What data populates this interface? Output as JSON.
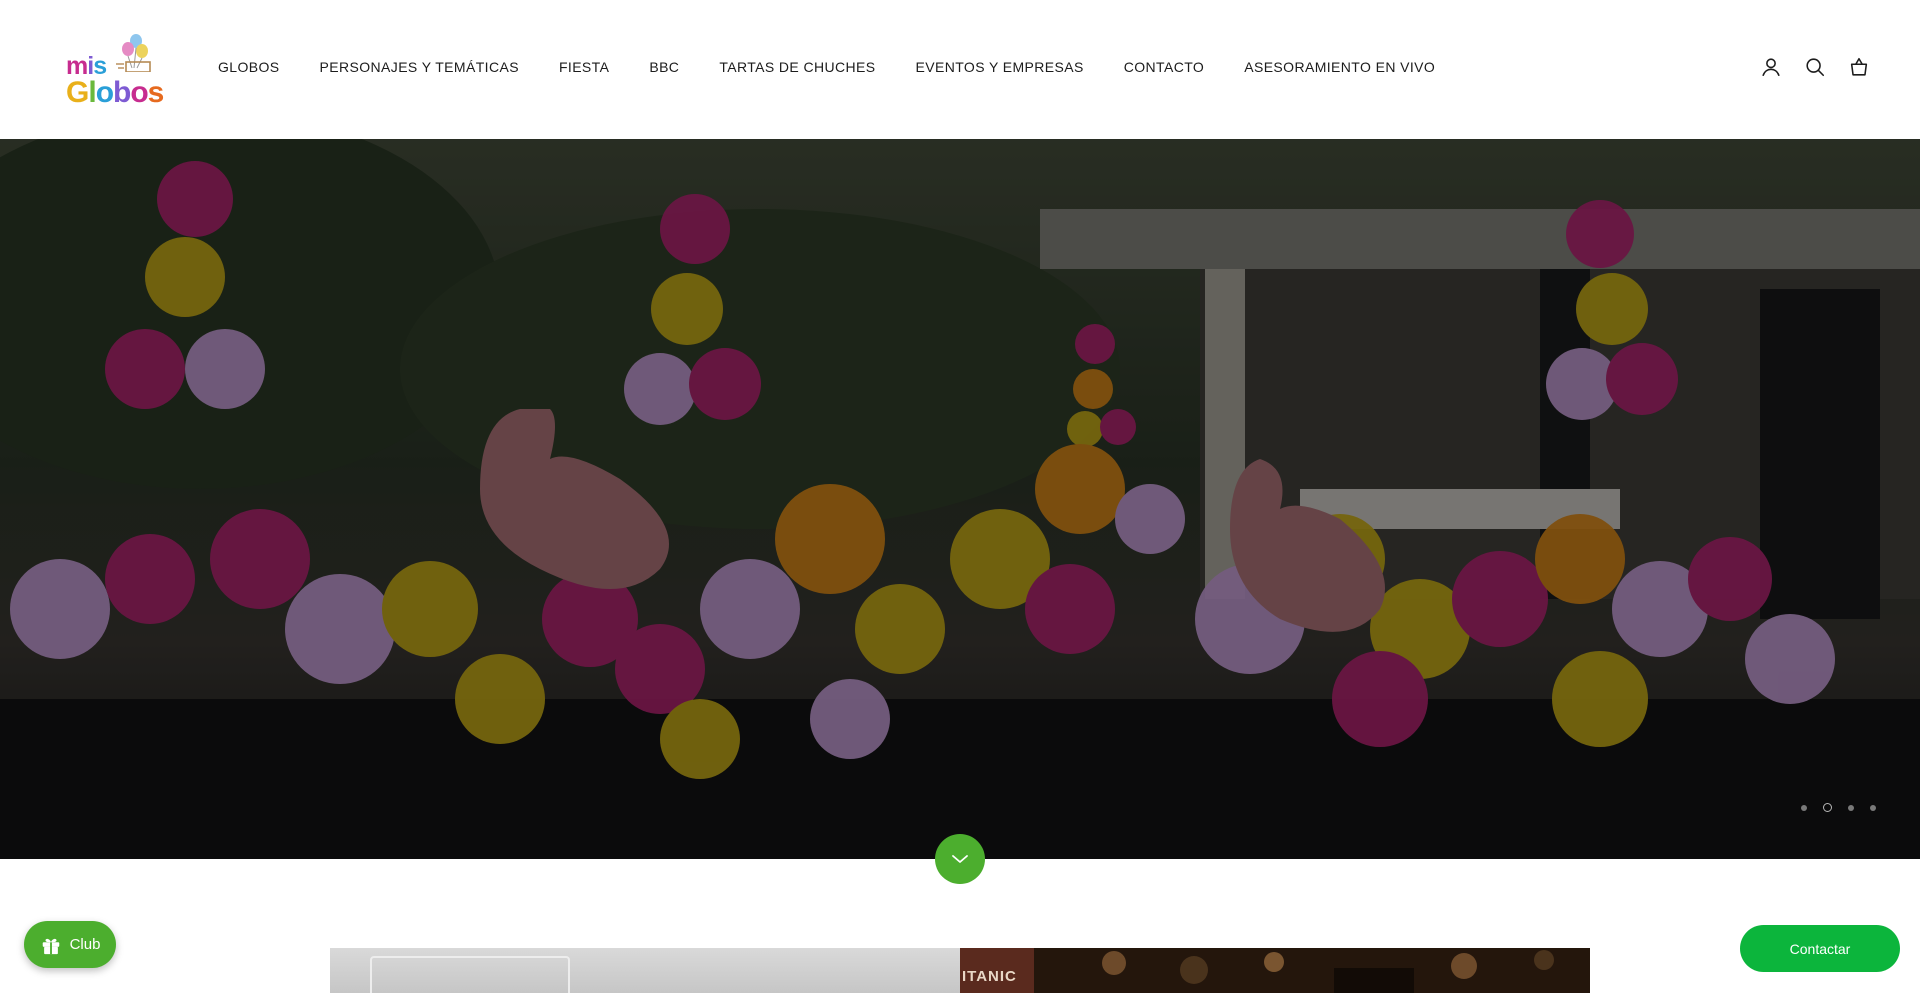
{
  "brand": {
    "logo_line1": [
      "m",
      "i",
      "s"
    ],
    "logo_line2": [
      "G",
      "l",
      "o",
      "b",
      "o",
      "s"
    ],
    "logo_colors": [
      "#c72c8f",
      "#7e5bd3",
      "#2a9fd8",
      "#e9b01a",
      "#6ab93c",
      "#e66a1f"
    ]
  },
  "nav": {
    "items": [
      "GLOBOS",
      "PERSONAJES Y TEMÁTICAS",
      "FIESTA",
      "BBC",
      "TARTAS DE CHUCHES",
      "EVENTOS Y EMPRESAS",
      "CONTACTO",
      "ASESORAMIENTO EN VIVO"
    ]
  },
  "header_icons": [
    "account-icon",
    "search-icon",
    "cart-icon"
  ],
  "hero": {
    "slide_count": 4,
    "active_slide": 2
  },
  "preview": {
    "right_sign_text": "ITANIC"
  },
  "floating": {
    "club_label": "Club",
    "contact_label": "Contactar"
  },
  "colors": {
    "accent_green": "#4cae2e",
    "contact_green": "#0cb53c"
  }
}
